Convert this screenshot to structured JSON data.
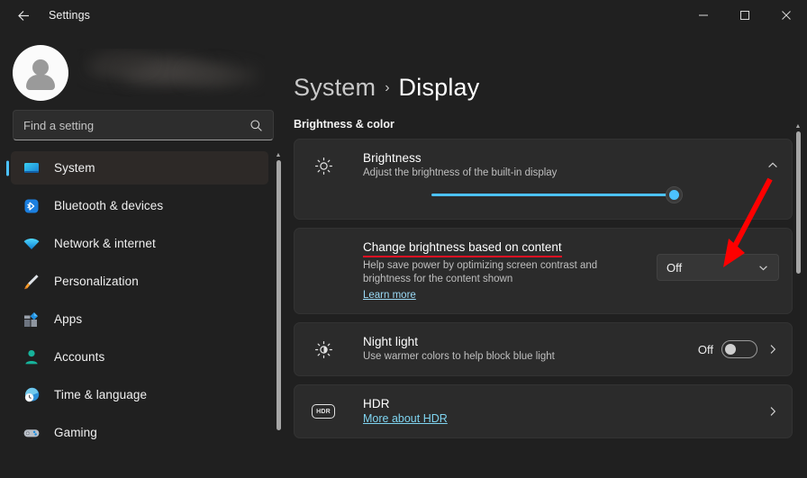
{
  "titlebar": {
    "back_icon": "arrow-left-icon",
    "title": "Settings",
    "minimize": "─",
    "maximize": "□",
    "close": "✕"
  },
  "sidebar": {
    "profile": {
      "avatar_icon": "person-avatar-icon",
      "name_blurred": ""
    },
    "search": {
      "placeholder": "Find a setting",
      "value": "",
      "icon": "search-icon"
    },
    "items": [
      {
        "label": "System",
        "icon": "monitor-icon",
        "selected": true
      },
      {
        "label": "Bluetooth & devices",
        "icon": "bluetooth-icon",
        "selected": false
      },
      {
        "label": "Network & internet",
        "icon": "wifi-icon",
        "selected": false
      },
      {
        "label": "Personalization",
        "icon": "paintbrush-icon",
        "selected": false
      },
      {
        "label": "Apps",
        "icon": "apps-icon",
        "selected": false
      },
      {
        "label": "Accounts",
        "icon": "account-icon",
        "selected": false
      },
      {
        "label": "Time & language",
        "icon": "clock-globe-icon",
        "selected": false
      },
      {
        "label": "Gaming",
        "icon": "gamepad-icon",
        "selected": false
      }
    ]
  },
  "main": {
    "breadcrumb": {
      "parent": "System",
      "separator": "›",
      "current": "Display"
    },
    "section_title": "Brightness & color",
    "brightness": {
      "title": "Brightness",
      "subtitle": "Adjust the brightness of the built-in display",
      "icon": "sun-icon",
      "expand_icon": "chevron-up-icon",
      "slider_value": 100,
      "slider_color": "#4cc2ff"
    },
    "content_brightness": {
      "title": "Change brightness based on content",
      "subtitle": "Help save power by optimizing screen contrast and brightness for the content shown",
      "link": "Learn more",
      "dropdown_value": "Off",
      "dropdown_icon": "chevron-down-icon",
      "highlight_color": "#e81123"
    },
    "night_light": {
      "title": "Night light",
      "subtitle": "Use warmer colors to help block blue light",
      "icon": "night-light-icon",
      "state_label": "Off",
      "toggle_on": false,
      "chevron": "chevron-right-icon"
    },
    "hdr": {
      "title": "HDR",
      "link": "More about HDR",
      "icon_text": "HDR",
      "chevron": "chevron-right-icon"
    }
  },
  "annotation": {
    "arrow_color": "#ff0000",
    "points_to": "Off"
  }
}
